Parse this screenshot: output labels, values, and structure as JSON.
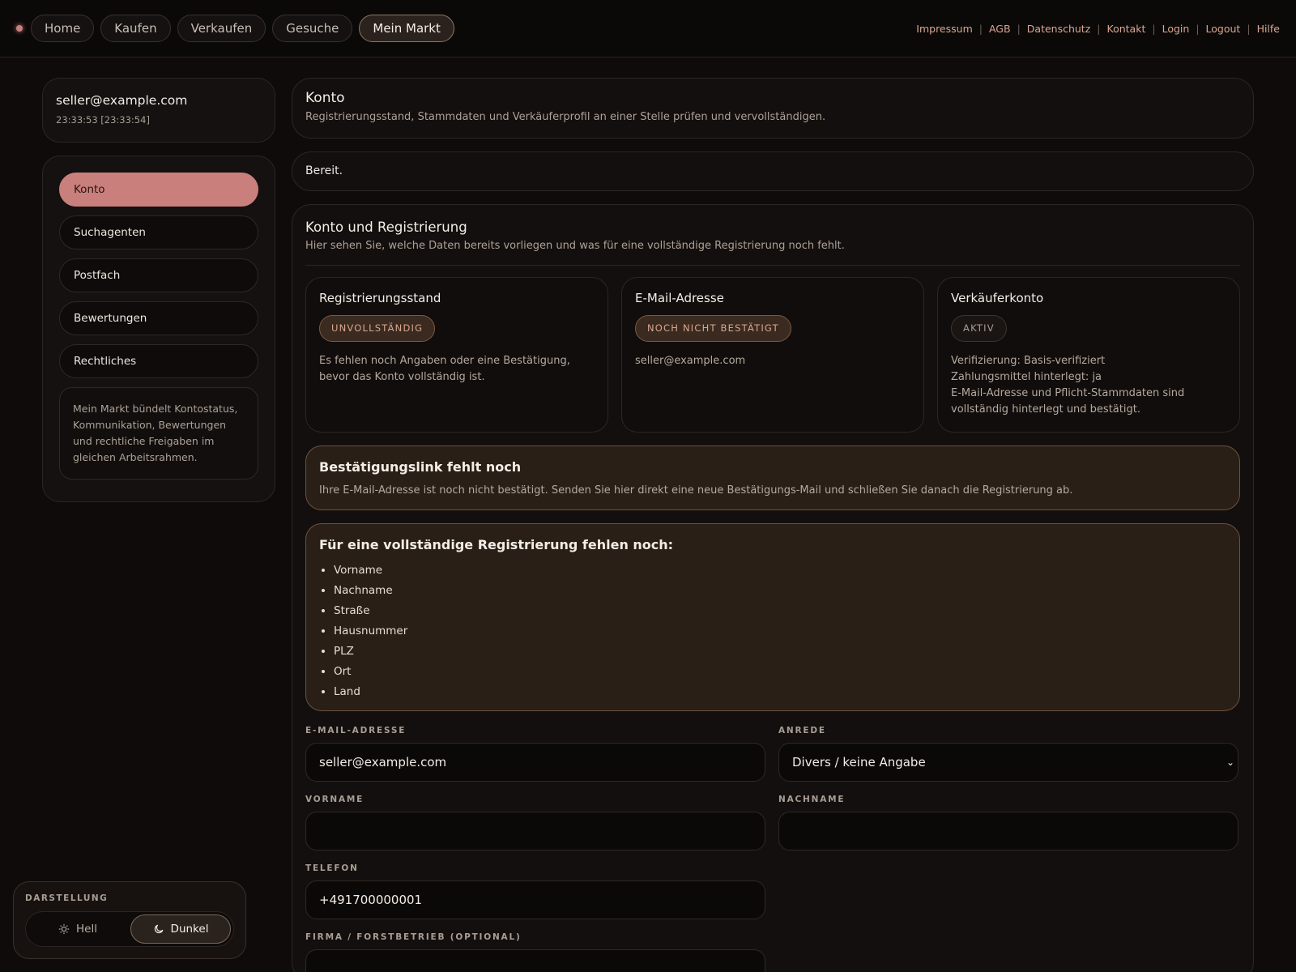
{
  "nav": {
    "items": [
      "Home",
      "Kaufen",
      "Verkaufen",
      "Gesuche",
      "Mein Markt"
    ],
    "active": "Mein Markt",
    "links": [
      "Impressum",
      "AGB",
      "Datenschutz",
      "Kontakt",
      "Login",
      "Logout",
      "Hilfe"
    ]
  },
  "user": {
    "email": "seller@example.com",
    "time": "23:33:53  [23:33:54]"
  },
  "sidebar": {
    "items": [
      "Konto",
      "Suchagenten",
      "Postfach",
      "Bewertungen",
      "Rechtliches"
    ],
    "active": "Konto",
    "note": "Mein Markt bündelt Kontostatus, Kommunikation, Bewertungen und rechtliche Freigaben im gleichen Arbeitsrahmen."
  },
  "theme": {
    "label": "DARSTELLUNG",
    "light": "Hell",
    "dark": "Dunkel",
    "active": "Dunkel"
  },
  "header": {
    "title": "Konto",
    "subtitle": "Registrierungsstand, Stammdaten und Verkäuferprofil an einer Stelle prüfen und vervollständigen."
  },
  "status": "Bereit.",
  "section": {
    "title": "Konto und Registrierung",
    "subtitle": "Hier sehen Sie, welche Daten bereits vorliegen und was für eine vollständige Registrierung noch fehlt."
  },
  "cards": [
    {
      "title": "Registrierungsstand",
      "badge": "UNVOLLSTÄNDIG",
      "text": "Es fehlen noch Angaben oder eine Bestätigung, bevor das Konto vollständig ist."
    },
    {
      "title": "E-Mail-Adresse",
      "badge": "NOCH NICHT BESTÄTIGT",
      "text": "seller@example.com"
    },
    {
      "title": "Verkäuferkonto",
      "badge": "AKTIV",
      "lines": [
        "Verifizierung: Basis-verifiziert",
        "Zahlungsmittel hinterlegt: ja",
        "E-Mail-Adresse und Pflicht-Stammdaten sind vollständig hinterlegt und bestätigt."
      ]
    }
  ],
  "alert": {
    "title": "Bestätigungslink fehlt noch",
    "text": "Ihre E-Mail-Adresse ist noch nicht bestätigt. Senden Sie hier direkt eine neue Bestätigungs-Mail und schließen Sie danach die Registrierung ab."
  },
  "missing": {
    "title": "Für eine vollständige Registrierung fehlen noch:",
    "items": [
      "Vorname",
      "Nachname",
      "Straße",
      "Hausnummer",
      "PLZ",
      "Ort",
      "Land"
    ]
  },
  "form": {
    "email_label": "E-MAIL-ADRESSE",
    "email_value": "seller@example.com",
    "anrede_label": "ANREDE",
    "anrede_value": "Divers / keine Angabe",
    "vorname_label": "VORNAME",
    "vorname_value": "",
    "nachname_label": "NACHNAME",
    "nachname_value": "",
    "telefon_label": "TELEFON",
    "telefon_value": "+491700000001",
    "firma_label": "FIRMA / FORSTBETRIEB (OPTIONAL)",
    "firma_value": ""
  },
  "colors": {
    "accent": "#c97f7b",
    "background": "#0e0b0a",
    "warning_bg": "#2a1f17"
  }
}
